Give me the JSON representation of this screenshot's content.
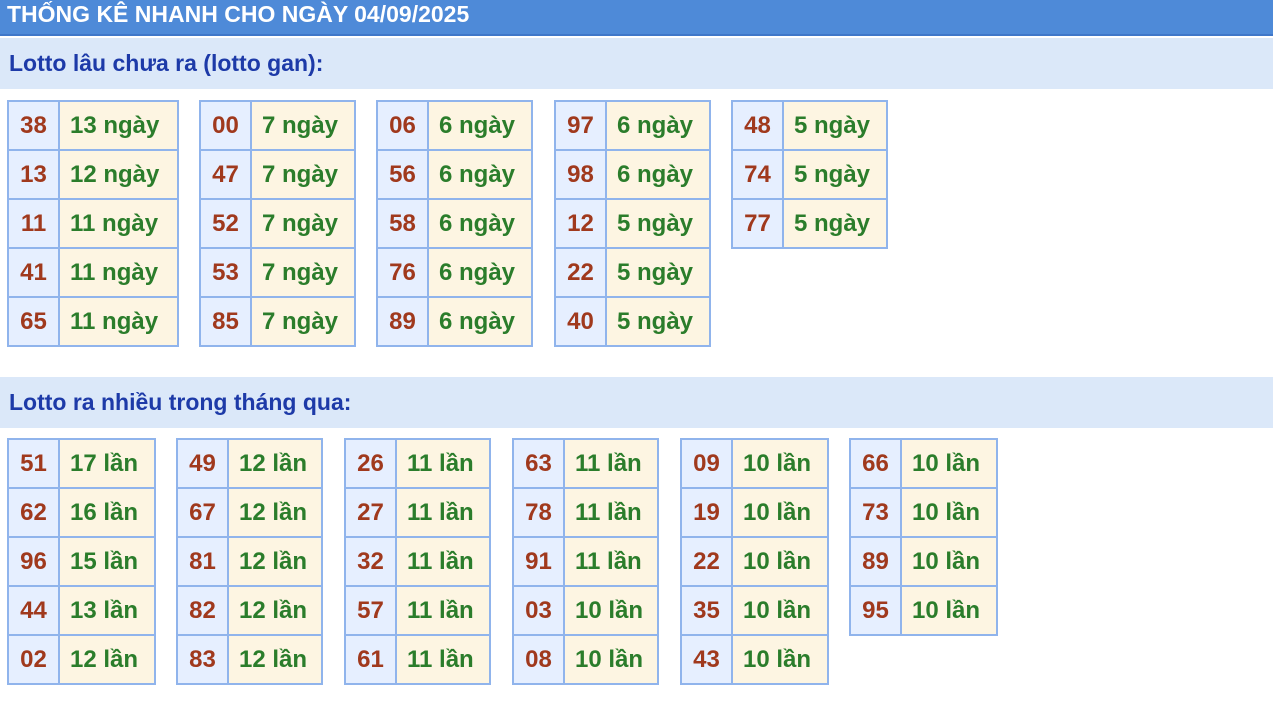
{
  "header": {
    "title": "THỐNG KÊ NHANH CHO NGÀY 04/09/2025"
  },
  "gan": {
    "title": "Lotto lâu chưa ra (lotto gan):",
    "columns": [
      [
        {
          "num": "38",
          "count": "13 ngày"
        },
        {
          "num": "13",
          "count": "12 ngày"
        },
        {
          "num": "11",
          "count": "11 ngày"
        },
        {
          "num": "41",
          "count": "11 ngày"
        },
        {
          "num": "65",
          "count": "11 ngày"
        }
      ],
      [
        {
          "num": "00",
          "count": "7 ngày"
        },
        {
          "num": "47",
          "count": "7 ngày"
        },
        {
          "num": "52",
          "count": "7 ngày"
        },
        {
          "num": "53",
          "count": "7 ngày"
        },
        {
          "num": "85",
          "count": "7 ngày"
        }
      ],
      [
        {
          "num": "06",
          "count": "6 ngày"
        },
        {
          "num": "56",
          "count": "6 ngày"
        },
        {
          "num": "58",
          "count": "6 ngày"
        },
        {
          "num": "76",
          "count": "6 ngày"
        },
        {
          "num": "89",
          "count": "6 ngày"
        }
      ],
      [
        {
          "num": "97",
          "count": "6 ngày"
        },
        {
          "num": "98",
          "count": "6 ngày"
        },
        {
          "num": "12",
          "count": "5 ngày"
        },
        {
          "num": "22",
          "count": "5 ngày"
        },
        {
          "num": "40",
          "count": "5 ngày"
        }
      ],
      [
        {
          "num": "48",
          "count": "5 ngày"
        },
        {
          "num": "74",
          "count": "5 ngày"
        },
        {
          "num": "77",
          "count": "5 ngày"
        }
      ]
    ]
  },
  "frequent": {
    "title": "Lotto ra nhiều trong tháng qua:",
    "columns": [
      [
        {
          "num": "51",
          "count": "17 lần"
        },
        {
          "num": "62",
          "count": "16 lần"
        },
        {
          "num": "96",
          "count": "15 lần"
        },
        {
          "num": "44",
          "count": "13 lần"
        },
        {
          "num": "02",
          "count": "12 lần"
        }
      ],
      [
        {
          "num": "49",
          "count": "12 lần"
        },
        {
          "num": "67",
          "count": "12 lần"
        },
        {
          "num": "81",
          "count": "12 lần"
        },
        {
          "num": "82",
          "count": "12 lần"
        },
        {
          "num": "83",
          "count": "12 lần"
        }
      ],
      [
        {
          "num": "26",
          "count": "11 lần"
        },
        {
          "num": "27",
          "count": "11 lần"
        },
        {
          "num": "32",
          "count": "11 lần"
        },
        {
          "num": "57",
          "count": "11 lần"
        },
        {
          "num": "61",
          "count": "11 lần"
        }
      ],
      [
        {
          "num": "63",
          "count": "11 lần"
        },
        {
          "num": "78",
          "count": "11 lần"
        },
        {
          "num": "91",
          "count": "11 lần"
        },
        {
          "num": "03",
          "count": "10 lần"
        },
        {
          "num": "08",
          "count": "10 lần"
        }
      ],
      [
        {
          "num": "09",
          "count": "10 lần"
        },
        {
          "num": "19",
          "count": "10 lần"
        },
        {
          "num": "22",
          "count": "10 lần"
        },
        {
          "num": "35",
          "count": "10 lần"
        },
        {
          "num": "43",
          "count": "10 lần"
        }
      ],
      [
        {
          "num": "66",
          "count": "10 lần"
        },
        {
          "num": "73",
          "count": "10 lần"
        },
        {
          "num": "89",
          "count": "10 lần"
        },
        {
          "num": "95",
          "count": "10 lần"
        }
      ]
    ]
  }
}
